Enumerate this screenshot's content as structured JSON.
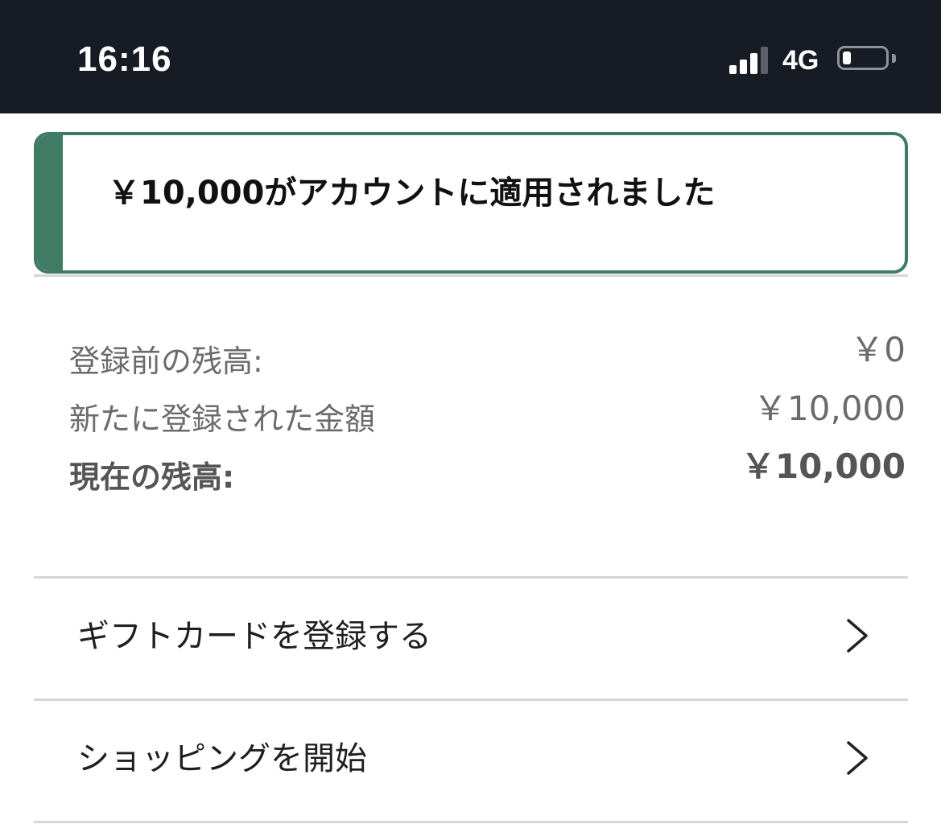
{
  "status_bar": {
    "time": "16:16",
    "network": "4G",
    "battery_level": 0.2
  },
  "alert": {
    "message": "￥10,000がアカウントに適用されました",
    "accent_color": "#3f7b65"
  },
  "balance": {
    "rows": [
      {
        "label": "登録前の残高:",
        "value": "￥0"
      },
      {
        "label": "新たに登録された金額",
        "value": "￥10,000"
      },
      {
        "label": "現在の残高:",
        "value": "￥10,000"
      }
    ]
  },
  "menu": {
    "items": [
      {
        "label": "ギフトカードを登録する",
        "icon": "chevron-right-icon"
      },
      {
        "label": "ショッピングを開始",
        "icon": "chevron-right-icon"
      }
    ]
  }
}
